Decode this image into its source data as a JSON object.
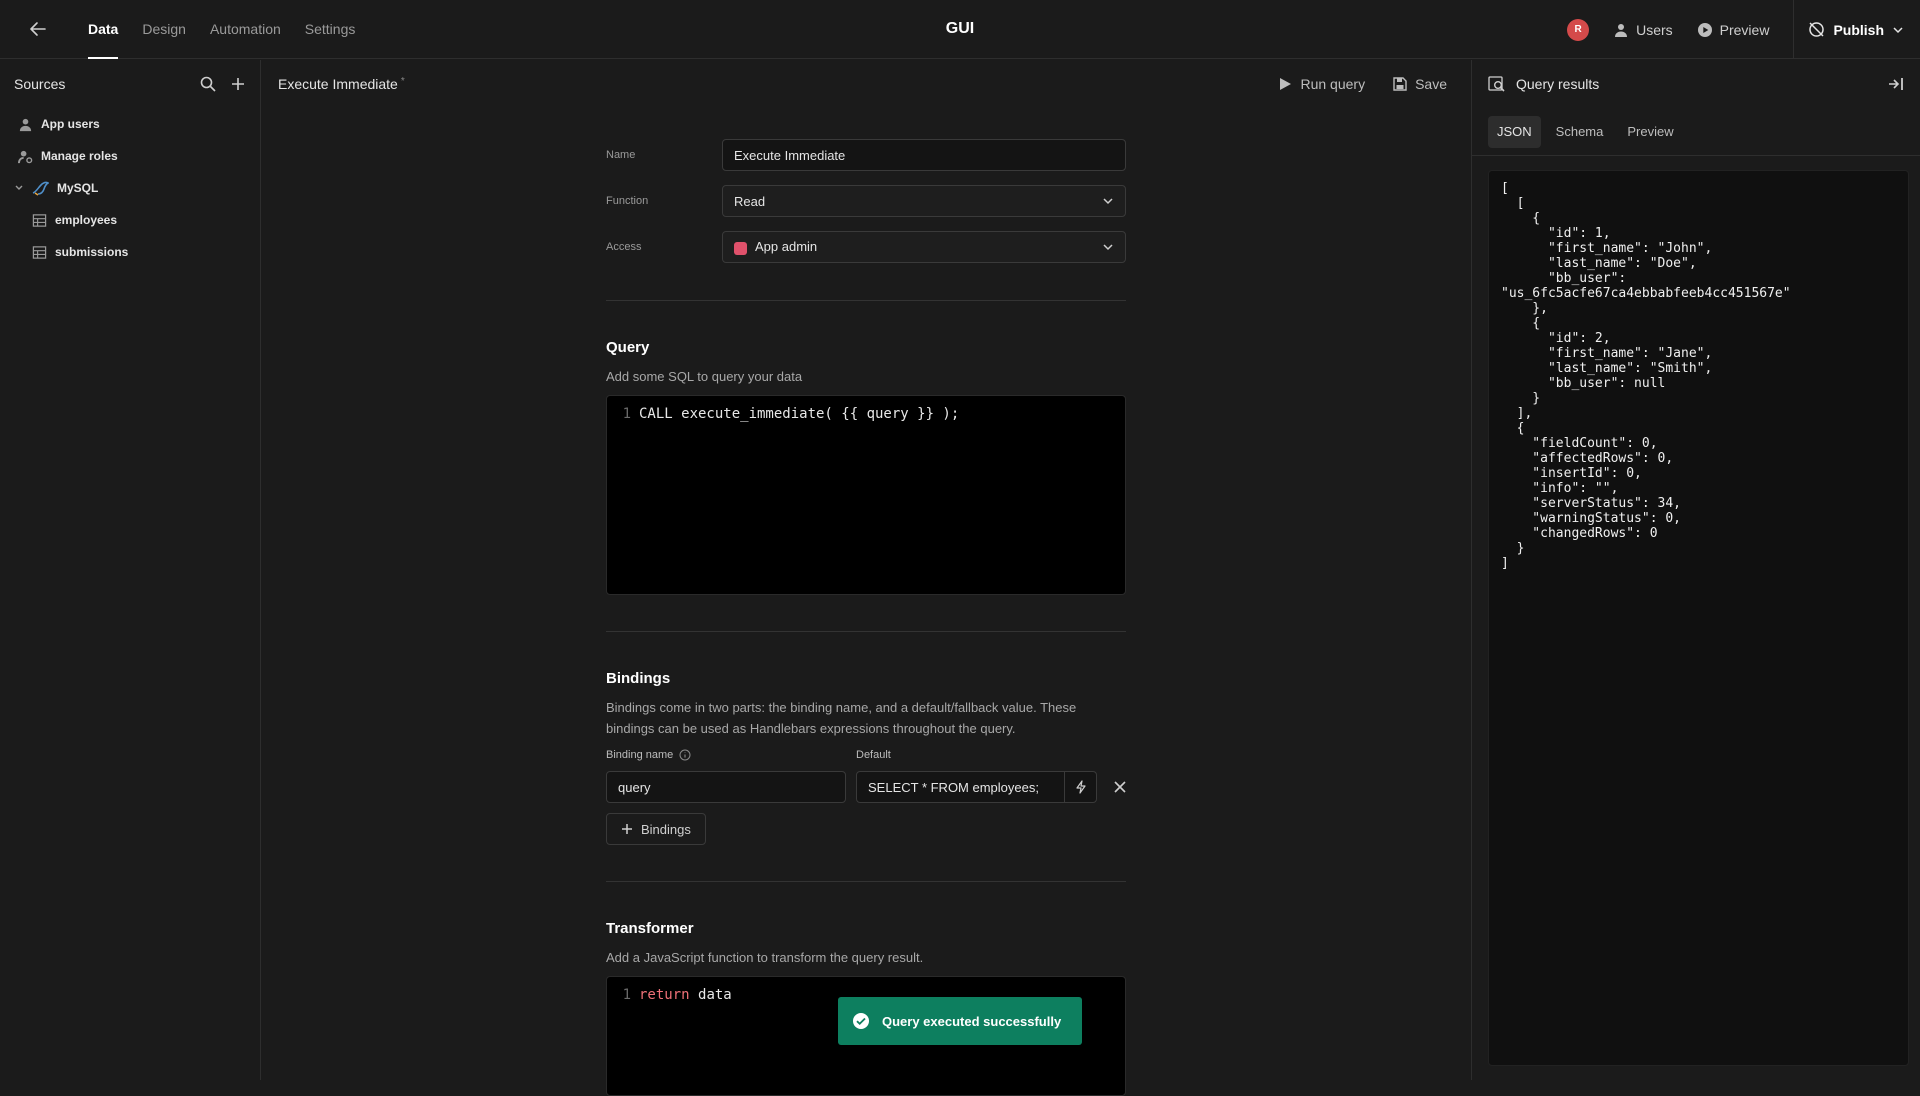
{
  "topbar": {
    "nav_tabs": [
      "Data",
      "Design",
      "Automation",
      "Settings"
    ],
    "app_title": "GUI",
    "avatar_initial": "R",
    "users_label": "Users",
    "preview_label": "Preview",
    "publish_label": "Publish"
  },
  "sidebar": {
    "title": "Sources",
    "items": [
      {
        "label": "App users",
        "icon": "user-icon"
      },
      {
        "label": "Manage roles",
        "icon": "roles-icon"
      },
      {
        "label": "MySQL",
        "icon": "mysql-icon"
      },
      {
        "label": "employees",
        "icon": "table-icon"
      },
      {
        "label": "submissions",
        "icon": "table-icon"
      }
    ]
  },
  "editor": {
    "query_title": "Execute Immediate",
    "dirty_marker": "*",
    "run_query_label": "Run query",
    "save_label": "Save",
    "name_label": "Name",
    "name_value": "Execute Immediate",
    "function_label": "Function",
    "function_value": "Read",
    "access_label": "Access",
    "access_value": "App admin",
    "access_color": "#e0516b",
    "query_section": {
      "title": "Query",
      "description": "Add some SQL to query your data",
      "line_number": "1",
      "code": "CALL execute_immediate( {{ query }} );"
    },
    "bindings_section": {
      "title": "Bindings",
      "description_line1": "Bindings come in two parts: the binding name, and a default/fallback value. These",
      "description_line2": "bindings can be used as Handlebars expressions throughout the query.",
      "binding_name_label": "Binding name",
      "default_label": "Default",
      "binding_name_value": "query",
      "default_value": "SELECT * FROM employees;",
      "add_button_label": "Bindings"
    },
    "transformer_section": {
      "title": "Transformer",
      "description": "Add a JavaScript function to transform the query result.",
      "line_number": "1",
      "code_keyword": "return",
      "code_rest": "data"
    }
  },
  "toast": {
    "message": "Query executed successfully",
    "color": "#0d7f5f"
  },
  "results": {
    "title": "Query results",
    "tabs": [
      "JSON",
      "Schema",
      "Preview"
    ],
    "json_text": "[\n  [\n    {\n      \"id\": 1,\n      \"first_name\": \"John\",\n      \"last_name\": \"Doe\",\n      \"bb_user\":\n\"us_6fc5acfe67ca4ebbabfeeb4cc451567e\"\n    },\n    {\n      \"id\": 2,\n      \"first_name\": \"Jane\",\n      \"last_name\": \"Smith\",\n      \"bb_user\": null\n    }\n  ],\n  {\n    \"fieldCount\": 0,\n    \"affectedRows\": 0,\n    \"insertId\": 0,\n    \"info\": \"\",\n    \"serverStatus\": 34,\n    \"warningStatus\": 0,\n    \"changedRows\": 0\n  }\n]"
  }
}
